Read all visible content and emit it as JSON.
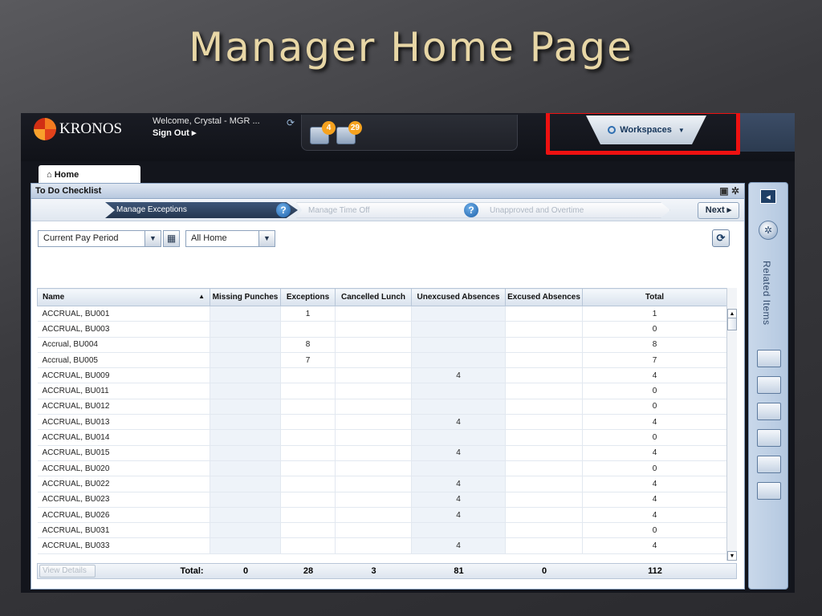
{
  "slide": {
    "title": "Manager Home Page"
  },
  "header": {
    "logo_text": "KRONOS",
    "welcome": "Welcome, Crystal - MGR ...",
    "sign_out": "Sign Out ▸",
    "notifications": [
      {
        "icon": "inbox-icon",
        "count": "4"
      },
      {
        "icon": "tasks-icon",
        "count": "29"
      }
    ],
    "workspaces_label": "Workspaces"
  },
  "tabs": {
    "home": "Home"
  },
  "panel": {
    "title": "To Do Checklist",
    "steps": [
      "Manage Exceptions",
      "Manage Time Off",
      "Unapproved and Overtime"
    ],
    "next_label": "Next ▸",
    "period_select": "Current Pay Period",
    "location_select": "All Home"
  },
  "table": {
    "columns": [
      "Name",
      "Missing Punches",
      "Exceptions",
      "Cancelled Lunch",
      "Unexcused Absences",
      "Excused Absences",
      "Total"
    ],
    "rows": [
      [
        "ACCRUAL, BU001",
        "",
        "1",
        "",
        "",
        "",
        "1"
      ],
      [
        "ACCRUAL, BU003",
        "",
        "",
        "",
        "",
        "",
        "0"
      ],
      [
        "Accrual, BU004",
        "",
        "8",
        "",
        "",
        "",
        "8"
      ],
      [
        "Accrual, BU005",
        "",
        "7",
        "",
        "",
        "",
        "7"
      ],
      [
        "ACCRUAL, BU009",
        "",
        "",
        "",
        "4",
        "",
        "4"
      ],
      [
        "ACCRUAL, BU011",
        "",
        "",
        "",
        "",
        "",
        "0"
      ],
      [
        "ACCRUAL, BU012",
        "",
        "",
        "",
        "",
        "",
        "0"
      ],
      [
        "ACCRUAL, BU013",
        "",
        "",
        "",
        "4",
        "",
        "4"
      ],
      [
        "ACCRUAL, BU014",
        "",
        "",
        "",
        "",
        "",
        "0"
      ],
      [
        "ACCRUAL, BU015",
        "",
        "",
        "",
        "4",
        "",
        "4"
      ],
      [
        "ACCRUAL, BU020",
        "",
        "",
        "",
        "",
        "",
        "0"
      ],
      [
        "ACCRUAL, BU022",
        "",
        "",
        "",
        "4",
        "",
        "4"
      ],
      [
        "ACCRUAL, BU023",
        "",
        "",
        "",
        "4",
        "",
        "4"
      ],
      [
        "ACCRUAL, BU026",
        "",
        "",
        "",
        "4",
        "",
        "4"
      ],
      [
        "ACCRUAL, BU031",
        "",
        "",
        "",
        "",
        "",
        "0"
      ],
      [
        "ACCRUAL, BU033",
        "",
        "",
        "",
        "4",
        "",
        "4"
      ]
    ],
    "totals": {
      "view_details": "View Details",
      "label": "Total:",
      "missing_punches": "0",
      "exceptions": "28",
      "cancelled_lunch": "3",
      "unexcused": "81",
      "excused": "0",
      "total": "112"
    }
  },
  "sidebar": {
    "label": "Related Items"
  },
  "colors": {
    "accent": "#24364f",
    "highlight": "#ee1111",
    "badge": "#f6a21e"
  }
}
